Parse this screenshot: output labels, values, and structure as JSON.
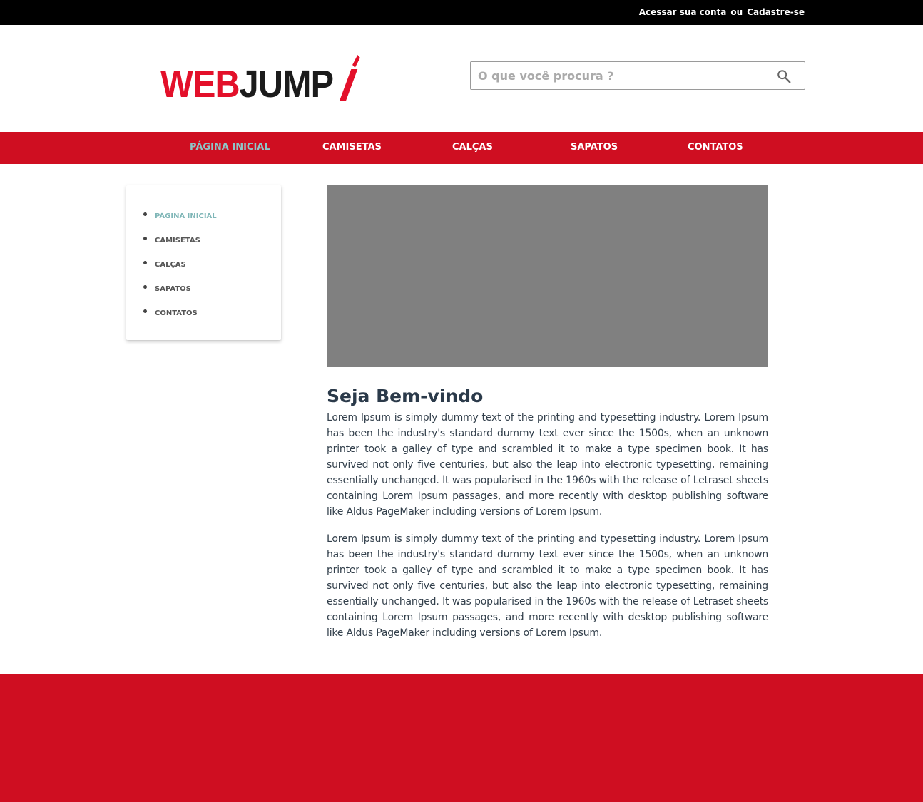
{
  "topbar": {
    "login_label": "Acessar sua conta",
    "or_label": "ou",
    "signup_label": "Cadastre-se"
  },
  "header": {
    "logo": {
      "part1": "WEB",
      "part2": "JUMP"
    },
    "search": {
      "placeholder": "O que você procura ?",
      "icon": "search-icon"
    }
  },
  "nav": {
    "items": [
      {
        "label": "Página inicial",
        "active": true
      },
      {
        "label": "Camisetas"
      },
      {
        "label": "Calças"
      },
      {
        "label": "Sapatos"
      },
      {
        "label": "Contatos"
      }
    ]
  },
  "sidebar": {
    "items": [
      {
        "label": "Página inicial",
        "active": true
      },
      {
        "label": "Camisetas"
      },
      {
        "label": "Calças"
      },
      {
        "label": "Sapatos"
      },
      {
        "label": "Contatos"
      }
    ]
  },
  "main": {
    "title": "Seja Bem-vindo",
    "paragraphs": [
      "Lorem Ipsum is simply dummy text of the printing and typesetting industry. Lorem Ipsum has been the industry's standard dummy text ever since the 1500s, when an unknown printer took a galley of type and scrambled it to make a type specimen book. It has survived not only five centuries, but also the leap into electronic typesetting, remaining essentially unchanged. It was popularised in the 1960s with the release of Letraset sheets containing Lorem Ipsum passages, and more recently with desktop publishing software like Aldus PageMaker including versions of Lorem Ipsum.",
      "Lorem Ipsum is simply dummy text of the printing and typesetting industry. Lorem Ipsum has been the industry's standard dummy text ever since the 1500s, when an unknown printer took a galley of type and scrambled it to make a type specimen book. It has survived not only five centuries, but also the leap into electronic typesetting, remaining essentially unchanged. It was popularised in the 1960s with the release of Letraset sheets containing Lorem Ipsum passages, and more recently with desktop publishing software like Aldus PageMaker including versions of Lorem Ipsum."
    ]
  },
  "colors": {
    "brand_red": "#cf0e21",
    "active_teal": "#8ec6c8",
    "topbar_black": "#000000",
    "banner_gray": "#808080"
  }
}
